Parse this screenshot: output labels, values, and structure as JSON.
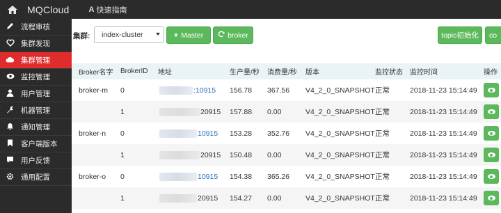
{
  "navbar": {
    "brand": "MQCloud",
    "guide_icon": "A",
    "guide_label": "快速指南"
  },
  "sidebar": {
    "items": [
      {
        "icon": "pencil-icon",
        "label": "流程审核",
        "active": false
      },
      {
        "icon": "heartbeat-icon",
        "label": "集群发现",
        "active": false
      },
      {
        "icon": "cloud-icon",
        "label": "集群管理",
        "active": true
      },
      {
        "icon": "eye-icon",
        "label": "监控管理",
        "active": false
      },
      {
        "icon": "user-icon",
        "label": "用户管理",
        "active": false
      },
      {
        "icon": "wrench-icon",
        "label": "机器管理",
        "active": false
      },
      {
        "icon": "bell-icon",
        "label": "通知管理",
        "active": false
      },
      {
        "icon": "bookmark-icon",
        "label": "客户端版本",
        "active": false
      },
      {
        "icon": "comment-icon",
        "label": "用户反馈",
        "active": false
      },
      {
        "icon": "gear-icon",
        "label": "通用配置",
        "active": false
      }
    ]
  },
  "toolbar": {
    "cluster_label": "集群:",
    "cluster_value": "index-cluster",
    "master_label": "Master",
    "broker_label": "broker",
    "topic_init_label": "topic初始化",
    "cut_label": "co"
  },
  "table": {
    "headers": [
      "Broker名字",
      "BrokerID",
      "地址",
      "生产量/秒",
      "消费量/秒",
      "版本",
      "监控状态",
      "监控时间",
      "操作"
    ],
    "rows": [
      {
        "name": "broker-m",
        "id": "0",
        "addr": ":10915",
        "produce": "156.78",
        "consume": "367.56",
        "version": "V4_2_0_SNAPSHOT",
        "status": "正常",
        "time": "2018-11-23 15:14:49"
      },
      {
        "name": "",
        "id": "1",
        "addr": "20915",
        "produce": "157.88",
        "consume": "0.00",
        "version": "V4_2_0_SNAPSHOT",
        "status": "正常",
        "time": "2018-11-23 15:14:49"
      },
      {
        "name": "broker-n",
        "id": "0",
        "addr": "10915",
        "produce": "153.28",
        "consume": "352.76",
        "version": "V4_2_0_SNAPSHOT",
        "status": "正常",
        "time": "2018-11-23 15:14:49"
      },
      {
        "name": "",
        "id": "1",
        "addr": "20915",
        "produce": "150.48",
        "consume": "0.00",
        "version": "V4_2_0_SNAPSHOT",
        "status": "正常",
        "time": "2018-11-23 15:14:49"
      },
      {
        "name": "broker-o",
        "id": "0",
        "addr": "10915",
        "produce": "154.38",
        "consume": "365.26",
        "version": "V4_2_0_SNAPSHOT",
        "status": "正常",
        "time": "2018-11-23 15:14:49"
      },
      {
        "name": "",
        "id": "1",
        "addr": "20915",
        "produce": "154.27",
        "consume": "0.00",
        "version": "V4_2_0_SNAPSHOT",
        "status": "正常",
        "time": "2018-11-23 15:14:49"
      }
    ]
  },
  "colors": {
    "navbar_bg": "#2b2b2b",
    "sidebar_active": "#e02c2c",
    "button_green": "#5cb85c",
    "table_header_bg": "#eaf3f6",
    "link_blue": "#2a6ebb"
  }
}
